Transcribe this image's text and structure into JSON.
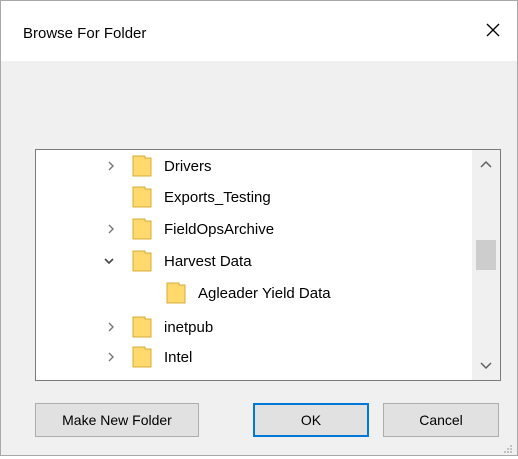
{
  "dialog": {
    "title": "Browse For Folder"
  },
  "icons": {
    "close": "close-icon",
    "folder": "folder-icon",
    "expand": "chevron-right-icon",
    "collapse": "chevron-down-icon"
  },
  "colors": {
    "folder_fill": "#ffd96b",
    "folder_stroke": "#d7ac3a",
    "accent": "#0078d7"
  },
  "tree": {
    "items": [
      {
        "label": "Drivers",
        "state": "collapsed",
        "indent": 0
      },
      {
        "label": "Exports_Testing",
        "state": "none",
        "indent": 0
      },
      {
        "label": "FieldOpsArchive",
        "state": "collapsed",
        "indent": 0
      },
      {
        "label": "Harvest Data",
        "state": "expanded",
        "indent": 0
      },
      {
        "label": "Agleader Yield Data",
        "state": "none",
        "indent": 1
      },
      {
        "label": "inetpub",
        "state": "collapsed",
        "indent": 0
      },
      {
        "label": "Intel",
        "state": "collapsed",
        "indent": 0
      }
    ]
  },
  "buttons": {
    "make_new_folder": "Make New Folder",
    "ok": "OK",
    "cancel": "Cancel"
  }
}
